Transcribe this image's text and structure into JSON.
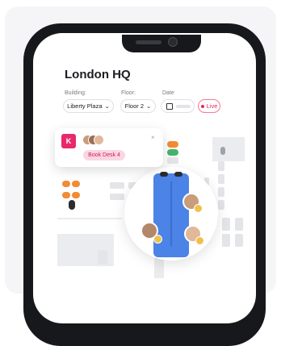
{
  "header": {
    "title": "London HQ"
  },
  "filters": {
    "building_label": "Building:",
    "building_value": "Liberty Plaza",
    "floor_label": "Floor:",
    "floor_value": "Floor 2",
    "date_label": "Date",
    "live_label": "Live"
  },
  "popup": {
    "logo_text": "K",
    "book_label": "Book Desk 4",
    "close_icon": "×"
  },
  "icons": {
    "title_chevron": "⌄",
    "select_chevron": "⌄",
    "calendar": "calendar-icon"
  },
  "colors": {
    "accent_pink": "#e8296c",
    "live_red": "#e8294f",
    "desk_blue": "#4b83e6",
    "orange": "#f28b33",
    "green": "#45b46a"
  }
}
